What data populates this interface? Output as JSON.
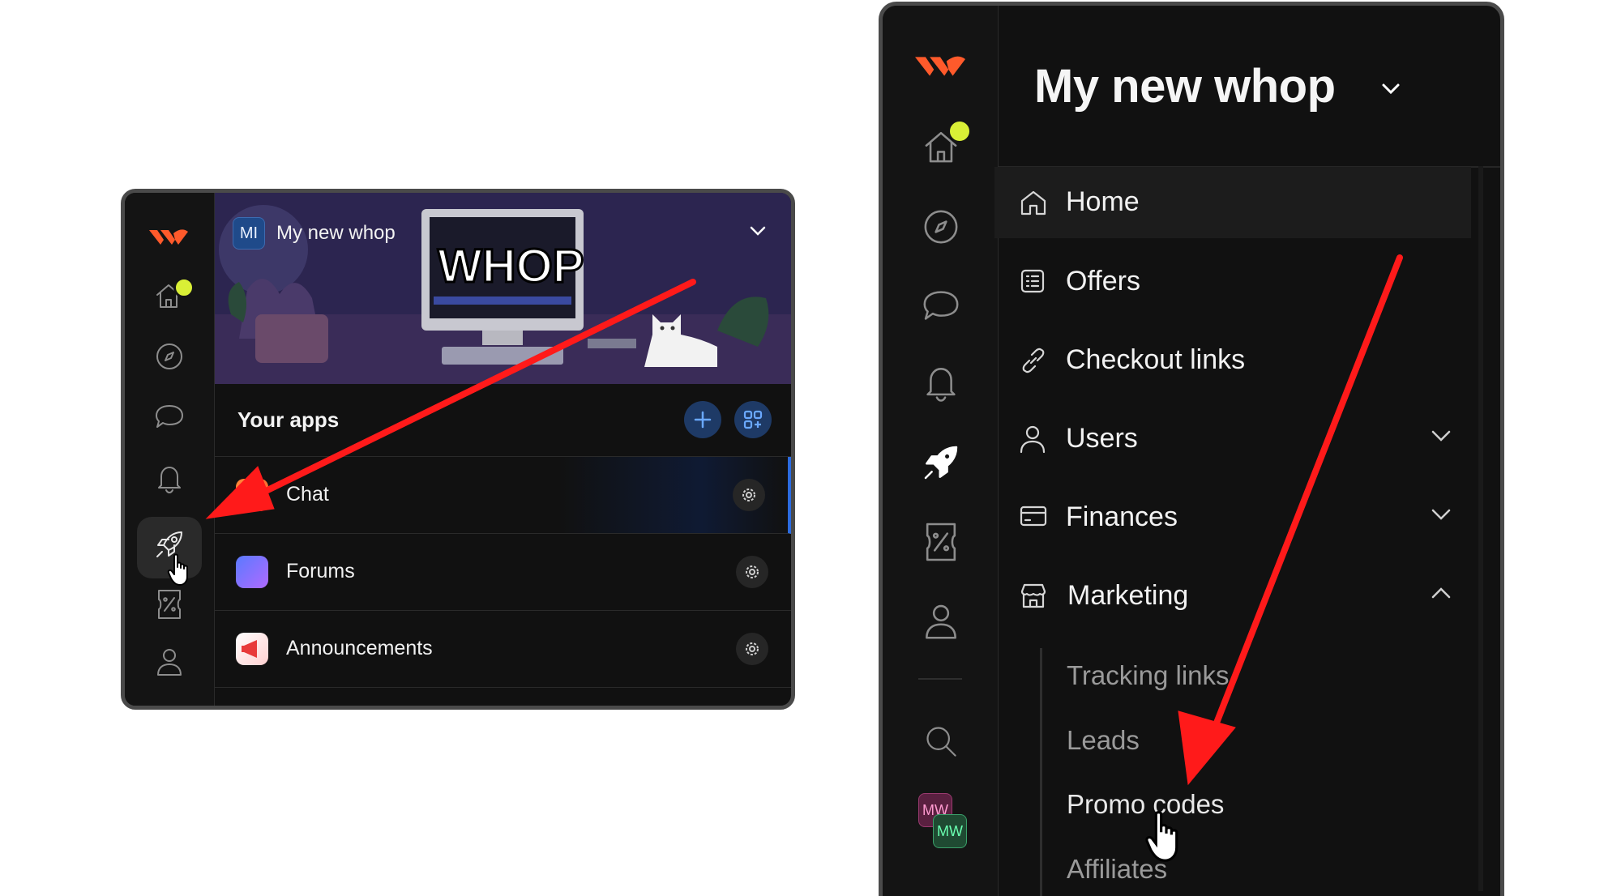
{
  "left_panel": {
    "workspace_badge": "MI",
    "workspace_name": "My new whop",
    "section_title": "Your apps",
    "apps": [
      {
        "label": "Chat",
        "icon": "chat-app-icon"
      },
      {
        "label": "Forums",
        "icon": "forums-app-icon"
      },
      {
        "label": "Announcements",
        "icon": "announcements-app-icon"
      }
    ],
    "rail_icons": [
      "whop-logo",
      "home-icon",
      "compass-icon",
      "chat-bubble-icon",
      "bell-icon",
      "rocket-icon",
      "coupon-icon",
      "user-icon"
    ]
  },
  "right_panel": {
    "title": "My new whop",
    "nav": [
      {
        "label": "Home",
        "icon": "home-icon"
      },
      {
        "label": "Offers",
        "icon": "offers-icon"
      },
      {
        "label": "Checkout links",
        "icon": "link-icon"
      },
      {
        "label": "Users",
        "icon": "user-icon"
      },
      {
        "label": "Finances",
        "icon": "card-icon"
      },
      {
        "label": "Marketing",
        "icon": "store-icon"
      }
    ],
    "marketing_sub": [
      "Tracking links",
      "Leads",
      "Promo codes",
      "Affiliates"
    ],
    "avatar_badge": "MW",
    "rail_icons": [
      "whop-logo",
      "home-icon",
      "compass-icon",
      "chat-bubble-icon",
      "bell-icon",
      "rocket-icon",
      "coupon-icon",
      "user-icon",
      "search-icon",
      "avatar"
    ]
  },
  "colors": {
    "accent_red": "#ff1a1a",
    "logo_orange": "#ff5a2b",
    "notification_dot": "#d9ef36",
    "panel_bg": "#111111"
  }
}
